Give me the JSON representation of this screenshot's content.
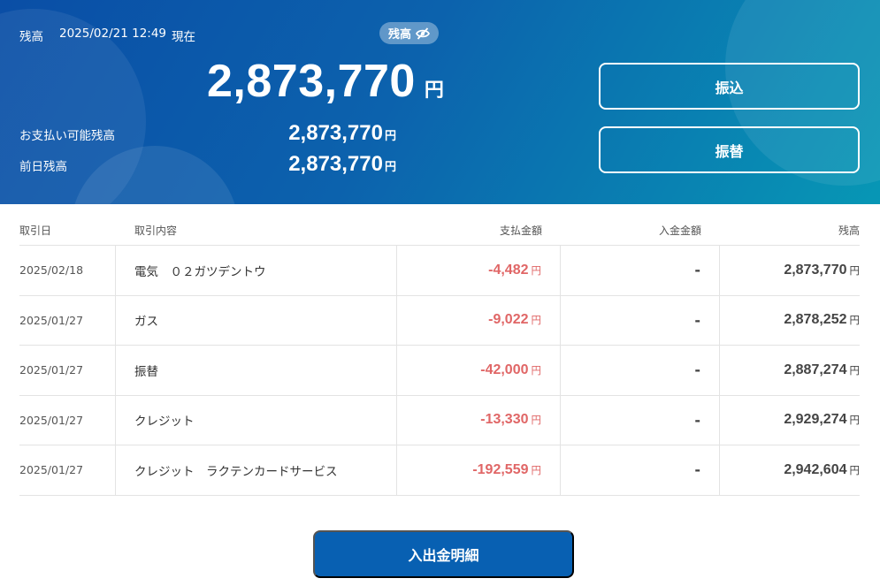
{
  "balance": {
    "label": "残高",
    "datetime": "2025/02/21 12:49",
    "as_of": "現在",
    "amount": "2,873,770",
    "currency": "円",
    "toggle_label": "残高",
    "toggle_icon": "eye-slash-icon",
    "available_label": "お支払い可能残高",
    "available_amount": "2,873,770",
    "previous_label": "前日残高",
    "previous_amount": "2,873,770"
  },
  "actions": {
    "transfer_label": "振込",
    "account_transfer_label": "振替"
  },
  "table": {
    "headers": {
      "date": "取引日",
      "description": "取引内容",
      "payment": "支払金額",
      "deposit": "入金金額",
      "balance": "残高"
    },
    "currency": "円",
    "rows": [
      {
        "date": "2025/02/18",
        "description": "電気　０２ガツデントウ",
        "payment": "-4,482",
        "deposit": "-",
        "balance": "2,873,770"
      },
      {
        "date": "2025/01/27",
        "description": "ガス",
        "payment": "-9,022",
        "deposit": "-",
        "balance": "2,878,252"
      },
      {
        "date": "2025/01/27",
        "description": "振替",
        "payment": "-42,000",
        "deposit": "-",
        "balance": "2,887,274"
      },
      {
        "date": "2025/01/27",
        "description": "クレジット",
        "payment": "-13,330",
        "deposit": "-",
        "balance": "2,929,274"
      },
      {
        "date": "2025/01/27",
        "description": "クレジット　ラクテンカードサービス",
        "payment": "-192,559",
        "deposit": "-",
        "balance": "2,942,604"
      }
    ]
  },
  "footer": {
    "detail_button_label": "入出金明細"
  },
  "colors": {
    "hero_start": "#0a4ea6",
    "hero_end": "#0797b5",
    "payment_red": "#e06666",
    "primary_button": "#0860b2"
  }
}
